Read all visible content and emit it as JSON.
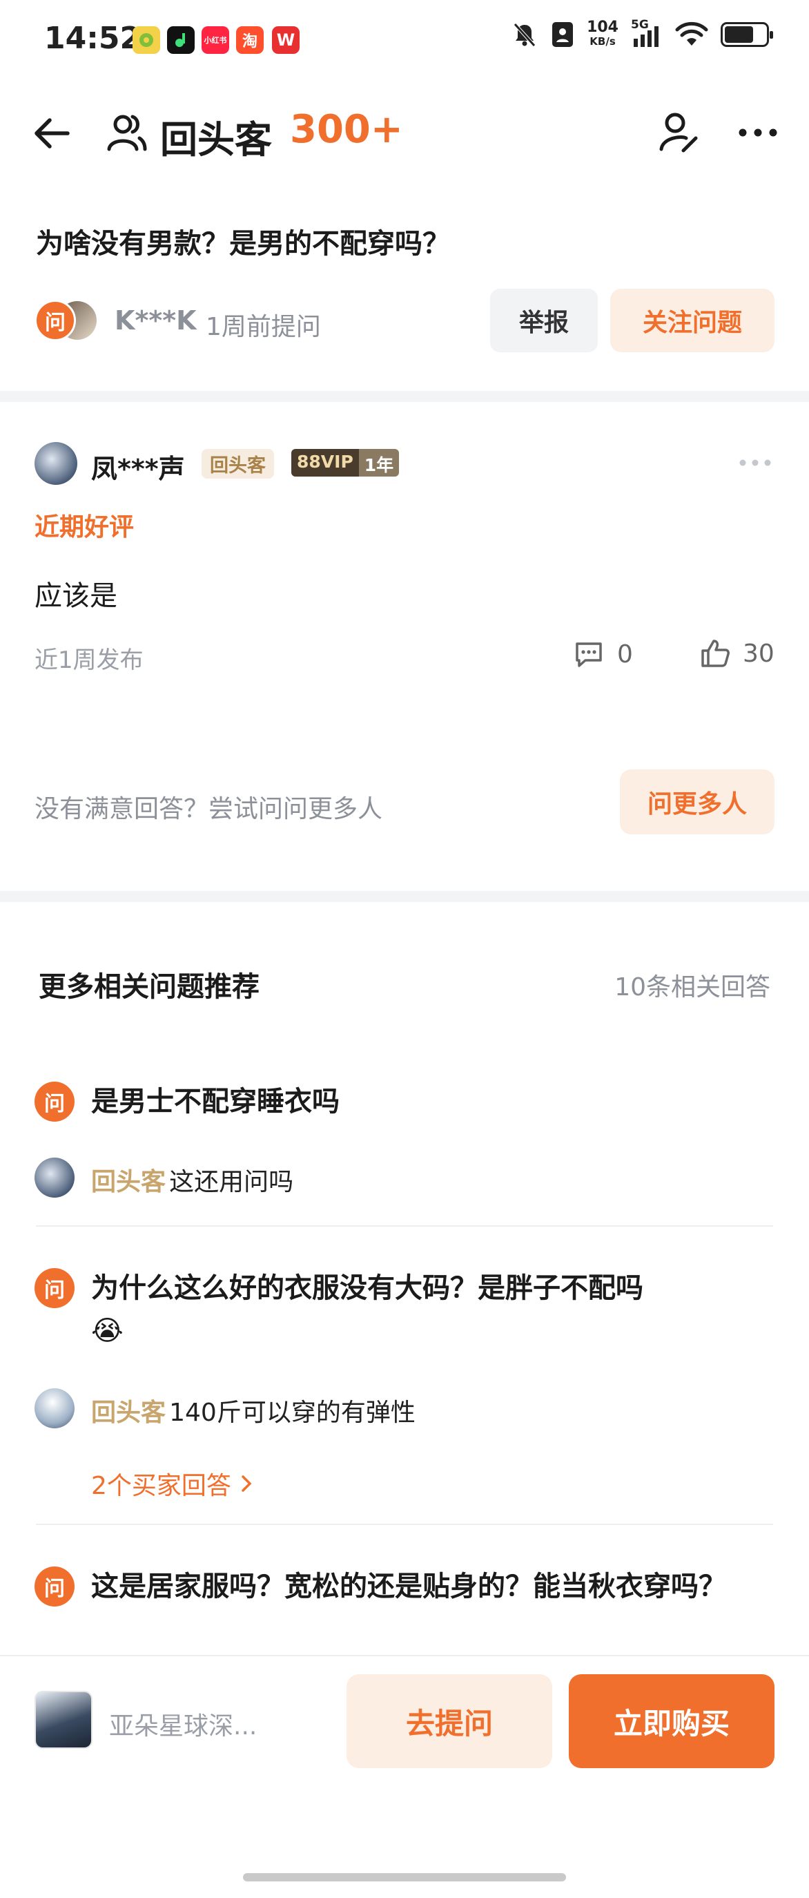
{
  "status_bar": {
    "time": "14:52",
    "app_icons": [
      {
        "name": "app-icon-1",
        "color": "#f3d24a",
        "text": ""
      },
      {
        "name": "app-icon-2",
        "color": "#111111",
        "text": ""
      },
      {
        "name": "xiaohongshu-icon",
        "color": "#ff2442",
        "text": "小红书"
      },
      {
        "name": "taobao-icon",
        "color": "#ff4f2c",
        "text": "淘"
      },
      {
        "name": "w-app-icon",
        "color": "#e83030",
        "text": "W"
      }
    ],
    "net_speed_value": "104",
    "net_speed_unit": "KB/s",
    "network": "5G"
  },
  "header": {
    "title": "回头客",
    "count": "300+"
  },
  "question": {
    "title": "为啥没有男款？是男的不配穿吗？",
    "badge": "问",
    "asker": "K***K",
    "time": "1周前提问",
    "report_label": "举报",
    "follow_label": "关注问题"
  },
  "answer": {
    "user": "凤***声",
    "tag": "回头客",
    "vip_level": "88VIP",
    "vip_years": "1年",
    "review_tag": "近期好评",
    "text": "应该是",
    "time": "近1周发布",
    "comments": "0",
    "likes": "30"
  },
  "ask_more": {
    "prompt": "没有满意回答？尝试问问更多人",
    "button": "问更多人"
  },
  "related": {
    "title": "更多相关问题推荐",
    "count_label": "10条相关回答",
    "items": [
      {
        "badge": "问",
        "question": "是男士不配穿睡衣吗",
        "tag": "回头客",
        "answer": "这还用问吗"
      },
      {
        "badge": "问",
        "question": "为什么这么好的衣服没有大码？是胖子不配吗",
        "emoji": "😭",
        "tag": "回头客",
        "answer": "140斤可以穿的有弹性",
        "more": "2个买家回答"
      },
      {
        "badge": "问",
        "question": "这是居家服吗？宽松的还是贴身的？能当秋衣穿吗？"
      }
    ]
  },
  "bottom_bar": {
    "product_name": "亚朵星球深...",
    "ask_label": "去提问",
    "buy_label": "立即购买"
  },
  "colors": {
    "accent": "#f06f2c",
    "accent_light": "#fdeee4",
    "gold": "#c8a56c"
  }
}
